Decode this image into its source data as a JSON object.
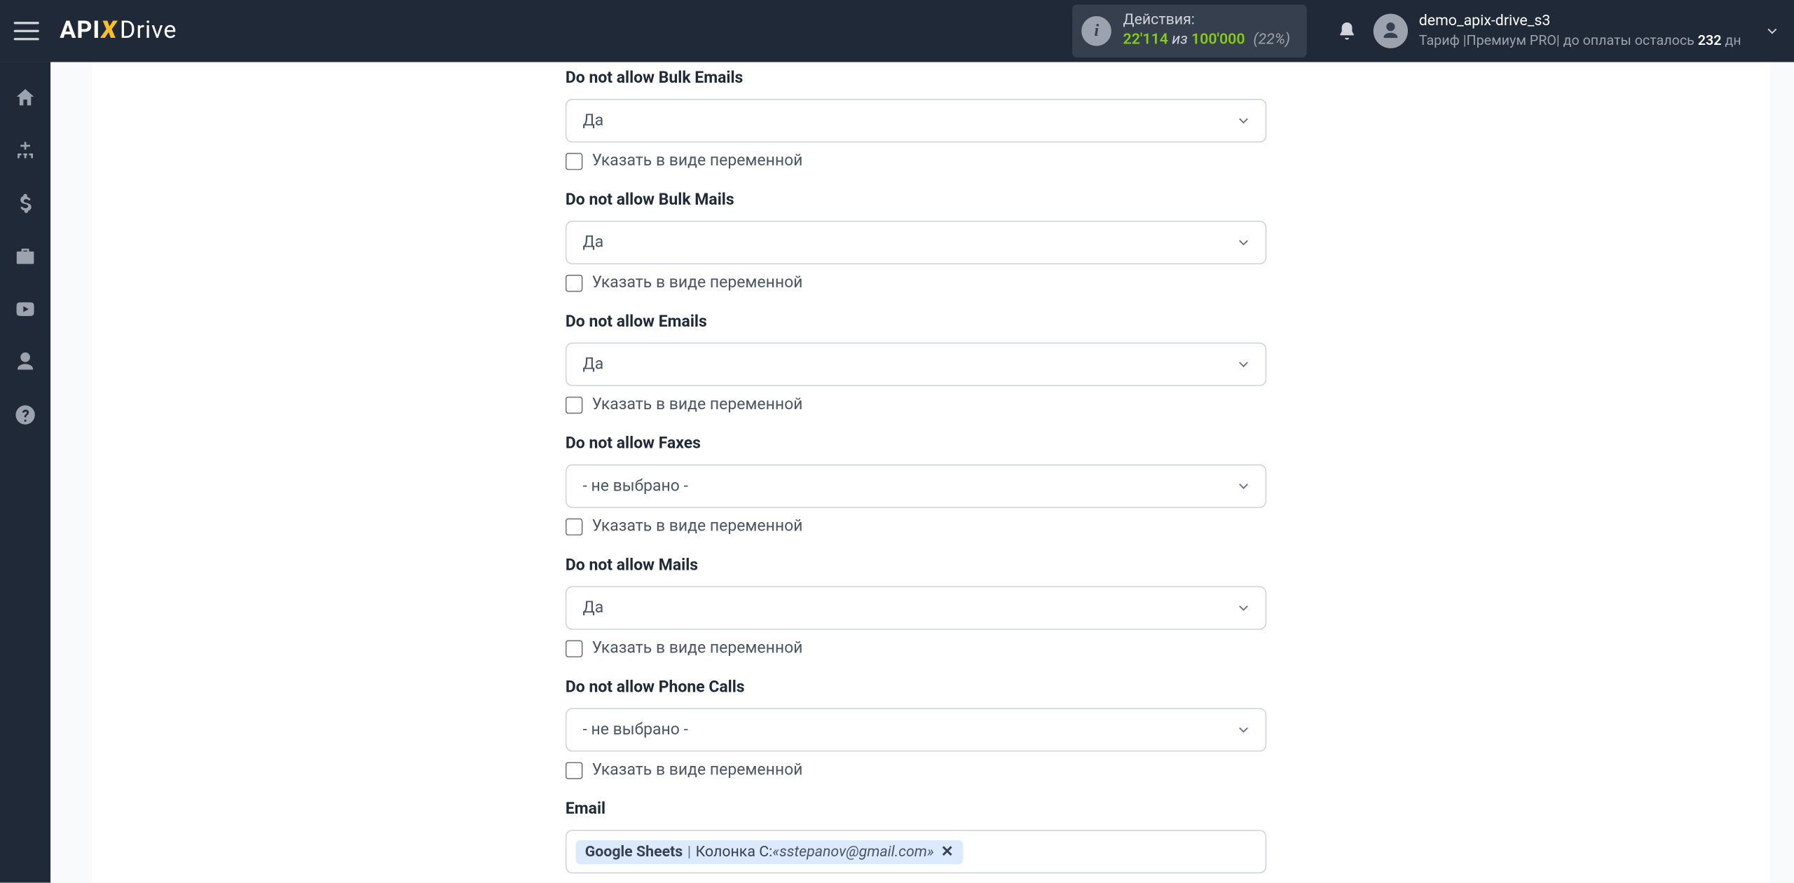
{
  "header": {
    "logo_api": "API",
    "logo_drive": "Drive",
    "actions": {
      "label": "Действия:",
      "current": "22'114",
      "of": "из",
      "total": "100'000",
      "pct": "(22%)"
    },
    "user": {
      "username": "demo_apix-drive_s3",
      "tariff_prefix": "Тариф |",
      "tariff_plan": "Премиум PRO",
      "tariff_sep": "|",
      "remaining_prefix": " до оплаты осталось ",
      "remaining_days": "232",
      "remaining_suffix": " дн"
    }
  },
  "sidebar": {
    "items": [
      {
        "name": "home"
      },
      {
        "name": "sitemap"
      },
      {
        "name": "dollar"
      },
      {
        "name": "briefcase"
      },
      {
        "name": "youtube"
      },
      {
        "name": "user"
      },
      {
        "name": "help"
      }
    ]
  },
  "fields": [
    {
      "label": "Do not allow Bulk Emails",
      "value": "Да",
      "checkbox": "Указать в виде переменной"
    },
    {
      "label": "Do not allow Bulk Mails",
      "value": "Да",
      "checkbox": "Указать в виде переменной"
    },
    {
      "label": "Do not allow Emails",
      "value": "Да",
      "checkbox": "Указать в виде переменной"
    },
    {
      "label": "Do not allow Faxes",
      "value": "- не выбрано -",
      "checkbox": "Указать в виде переменной"
    },
    {
      "label": "Do not allow Mails",
      "value": "Да",
      "checkbox": "Указать в виде переменной"
    },
    {
      "label": "Do not allow Phone Calls",
      "value": "- не выбрано -",
      "checkbox": "Указать в виде переменной"
    }
  ],
  "email_field": {
    "label": "Email",
    "token": {
      "source": "Google Sheets",
      "column_label": "Колонка C:",
      "value": "«sstepanov@gmail.com»"
    }
  }
}
